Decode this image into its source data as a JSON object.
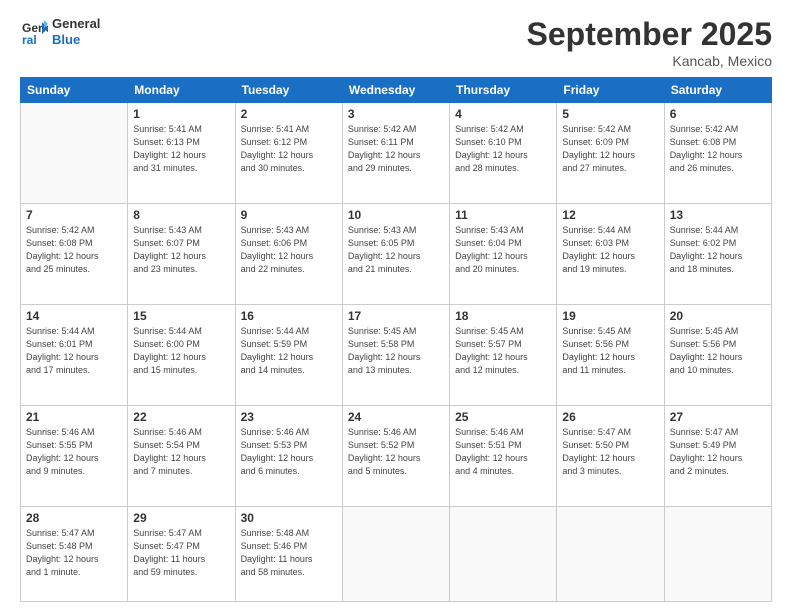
{
  "header": {
    "logo": {
      "line1": "General",
      "line2": "Blue"
    },
    "title": "September 2025",
    "location": "Kancab, Mexico"
  },
  "weekdays": [
    "Sunday",
    "Monday",
    "Tuesday",
    "Wednesday",
    "Thursday",
    "Friday",
    "Saturday"
  ],
  "weeks": [
    [
      {
        "day": "",
        "info": ""
      },
      {
        "day": "1",
        "info": "Sunrise: 5:41 AM\nSunset: 6:13 PM\nDaylight: 12 hours\nand 31 minutes."
      },
      {
        "day": "2",
        "info": "Sunrise: 5:41 AM\nSunset: 6:12 PM\nDaylight: 12 hours\nand 30 minutes."
      },
      {
        "day": "3",
        "info": "Sunrise: 5:42 AM\nSunset: 6:11 PM\nDaylight: 12 hours\nand 29 minutes."
      },
      {
        "day": "4",
        "info": "Sunrise: 5:42 AM\nSunset: 6:10 PM\nDaylight: 12 hours\nand 28 minutes."
      },
      {
        "day": "5",
        "info": "Sunrise: 5:42 AM\nSunset: 6:09 PM\nDaylight: 12 hours\nand 27 minutes."
      },
      {
        "day": "6",
        "info": "Sunrise: 5:42 AM\nSunset: 6:08 PM\nDaylight: 12 hours\nand 26 minutes."
      }
    ],
    [
      {
        "day": "7",
        "info": "Sunrise: 5:42 AM\nSunset: 6:08 PM\nDaylight: 12 hours\nand 25 minutes."
      },
      {
        "day": "8",
        "info": "Sunrise: 5:43 AM\nSunset: 6:07 PM\nDaylight: 12 hours\nand 23 minutes."
      },
      {
        "day": "9",
        "info": "Sunrise: 5:43 AM\nSunset: 6:06 PM\nDaylight: 12 hours\nand 22 minutes."
      },
      {
        "day": "10",
        "info": "Sunrise: 5:43 AM\nSunset: 6:05 PM\nDaylight: 12 hours\nand 21 minutes."
      },
      {
        "day": "11",
        "info": "Sunrise: 5:43 AM\nSunset: 6:04 PM\nDaylight: 12 hours\nand 20 minutes."
      },
      {
        "day": "12",
        "info": "Sunrise: 5:44 AM\nSunset: 6:03 PM\nDaylight: 12 hours\nand 19 minutes."
      },
      {
        "day": "13",
        "info": "Sunrise: 5:44 AM\nSunset: 6:02 PM\nDaylight: 12 hours\nand 18 minutes."
      }
    ],
    [
      {
        "day": "14",
        "info": "Sunrise: 5:44 AM\nSunset: 6:01 PM\nDaylight: 12 hours\nand 17 minutes."
      },
      {
        "day": "15",
        "info": "Sunrise: 5:44 AM\nSunset: 6:00 PM\nDaylight: 12 hours\nand 15 minutes."
      },
      {
        "day": "16",
        "info": "Sunrise: 5:44 AM\nSunset: 5:59 PM\nDaylight: 12 hours\nand 14 minutes."
      },
      {
        "day": "17",
        "info": "Sunrise: 5:45 AM\nSunset: 5:58 PM\nDaylight: 12 hours\nand 13 minutes."
      },
      {
        "day": "18",
        "info": "Sunrise: 5:45 AM\nSunset: 5:57 PM\nDaylight: 12 hours\nand 12 minutes."
      },
      {
        "day": "19",
        "info": "Sunrise: 5:45 AM\nSunset: 5:56 PM\nDaylight: 12 hours\nand 11 minutes."
      },
      {
        "day": "20",
        "info": "Sunrise: 5:45 AM\nSunset: 5:56 PM\nDaylight: 12 hours\nand 10 minutes."
      }
    ],
    [
      {
        "day": "21",
        "info": "Sunrise: 5:46 AM\nSunset: 5:55 PM\nDaylight: 12 hours\nand 9 minutes."
      },
      {
        "day": "22",
        "info": "Sunrise: 5:46 AM\nSunset: 5:54 PM\nDaylight: 12 hours\nand 7 minutes."
      },
      {
        "day": "23",
        "info": "Sunrise: 5:46 AM\nSunset: 5:53 PM\nDaylight: 12 hours\nand 6 minutes."
      },
      {
        "day": "24",
        "info": "Sunrise: 5:46 AM\nSunset: 5:52 PM\nDaylight: 12 hours\nand 5 minutes."
      },
      {
        "day": "25",
        "info": "Sunrise: 5:46 AM\nSunset: 5:51 PM\nDaylight: 12 hours\nand 4 minutes."
      },
      {
        "day": "26",
        "info": "Sunrise: 5:47 AM\nSunset: 5:50 PM\nDaylight: 12 hours\nand 3 minutes."
      },
      {
        "day": "27",
        "info": "Sunrise: 5:47 AM\nSunset: 5:49 PM\nDaylight: 12 hours\nand 2 minutes."
      }
    ],
    [
      {
        "day": "28",
        "info": "Sunrise: 5:47 AM\nSunset: 5:48 PM\nDaylight: 12 hours\nand 1 minute."
      },
      {
        "day": "29",
        "info": "Sunrise: 5:47 AM\nSunset: 5:47 PM\nDaylight: 11 hours\nand 59 minutes."
      },
      {
        "day": "30",
        "info": "Sunrise: 5:48 AM\nSunset: 5:46 PM\nDaylight: 11 hours\nand 58 minutes."
      },
      {
        "day": "",
        "info": ""
      },
      {
        "day": "",
        "info": ""
      },
      {
        "day": "",
        "info": ""
      },
      {
        "day": "",
        "info": ""
      }
    ]
  ]
}
